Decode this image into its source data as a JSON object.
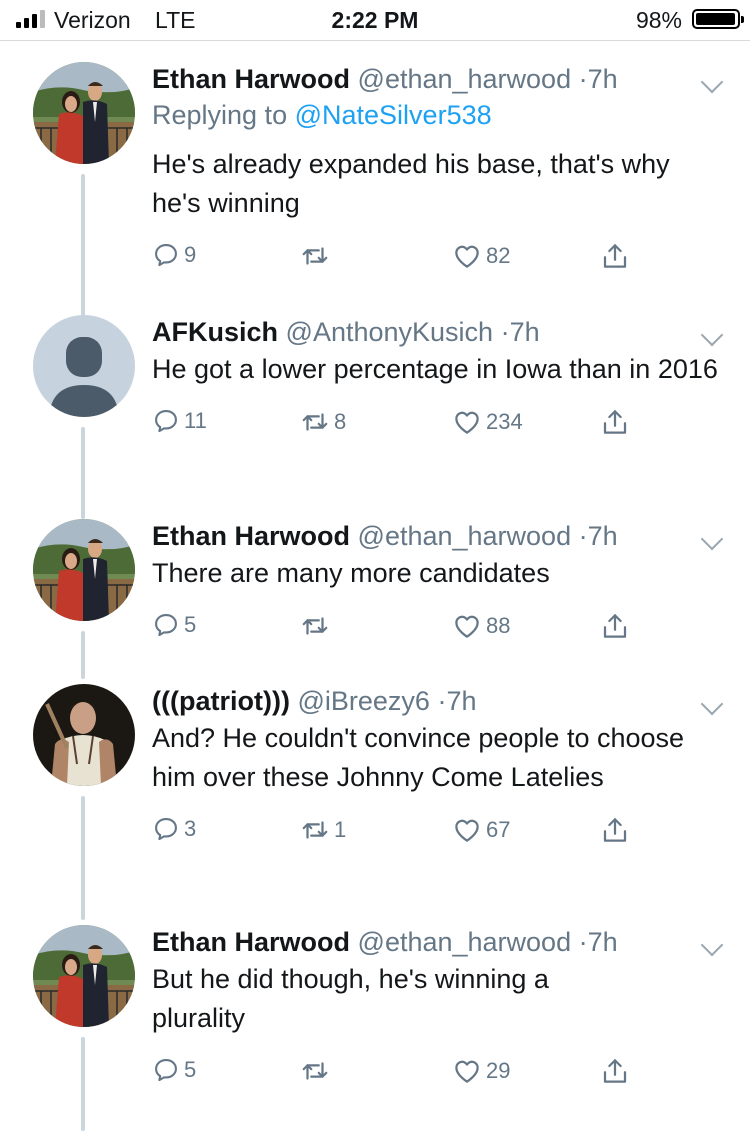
{
  "status_bar": {
    "carrier": "Verizon",
    "network": "LTE",
    "time": "2:22 PM",
    "battery": "98%",
    "battery_level": 0.98
  },
  "tweets": [
    {
      "name": "Ethan Harwood",
      "handle": "@ethan_harwood",
      "dot": "·",
      "time": "7h",
      "reply_prefix": "Replying to",
      "reply_handle": "@NateSilver538",
      "text": "He's already expanded his base, that's why he's winning",
      "replies": "9",
      "retweets": "",
      "likes": "82",
      "avatar": "photo-couple"
    },
    {
      "name": "AFKusich",
      "handle": "@AnthonyKusich",
      "dot": "·",
      "time": "7h",
      "text": "He got a lower percentage in Iowa than in 2016",
      "replies": "11",
      "retweets": "8",
      "likes": "234",
      "avatar": "default-profile"
    },
    {
      "name": "Ethan Harwood",
      "handle": "@ethan_harwood",
      "dot": "·",
      "time": "7h",
      "text": "There are many more candidates",
      "replies": "5",
      "retweets": "",
      "likes": "88",
      "avatar": "photo-couple"
    },
    {
      "name": "(((patriot)))",
      "handle": "@iBreezy6",
      "dot": "·",
      "time": "7h",
      "text": "And? He couldn't convince people to choose him over these Johnny Come Latelies",
      "replies": "3",
      "retweets": "1",
      "likes": "67",
      "avatar": "photo-man"
    },
    {
      "name": "Ethan Harwood",
      "handle": "@ethan_harwood",
      "dot": "·",
      "time": "7h",
      "text": "But he did though, he's winning a plurality",
      "replies": "5",
      "retweets": "",
      "likes": "29",
      "avatar": "photo-couple"
    }
  ],
  "colors": {
    "link": "#1da1f2",
    "secondary_text": "#657786",
    "thread_line": "#cdd5dc"
  }
}
